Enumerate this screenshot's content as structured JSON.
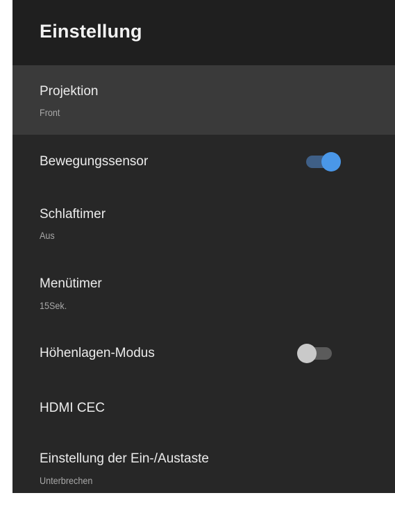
{
  "header": {
    "title": "Einstellung"
  },
  "items": [
    {
      "label": "Projektion",
      "value": "Front"
    },
    {
      "label": "Bewegungssensor",
      "toggle": "on"
    },
    {
      "label": "Schlaftimer",
      "value": "Aus"
    },
    {
      "label": "Menütimer",
      "value": "15Sek."
    },
    {
      "label": "Höhenlagen-Modus",
      "toggle": "off"
    },
    {
      "label": "HDMI CEC"
    },
    {
      "label": "Einstellung der Ein-/Austaste",
      "value": "Unterbrechen"
    }
  ],
  "colors": {
    "background": "#272727",
    "header": "#1f1f1f",
    "selected_row": "#3a3a3a",
    "toggle_on_knob": "#4a97e8",
    "toggle_on_track": "#3f5f86",
    "toggle_off_knob": "#c9c9c9",
    "toggle_off_track": "#5b5b5b"
  }
}
